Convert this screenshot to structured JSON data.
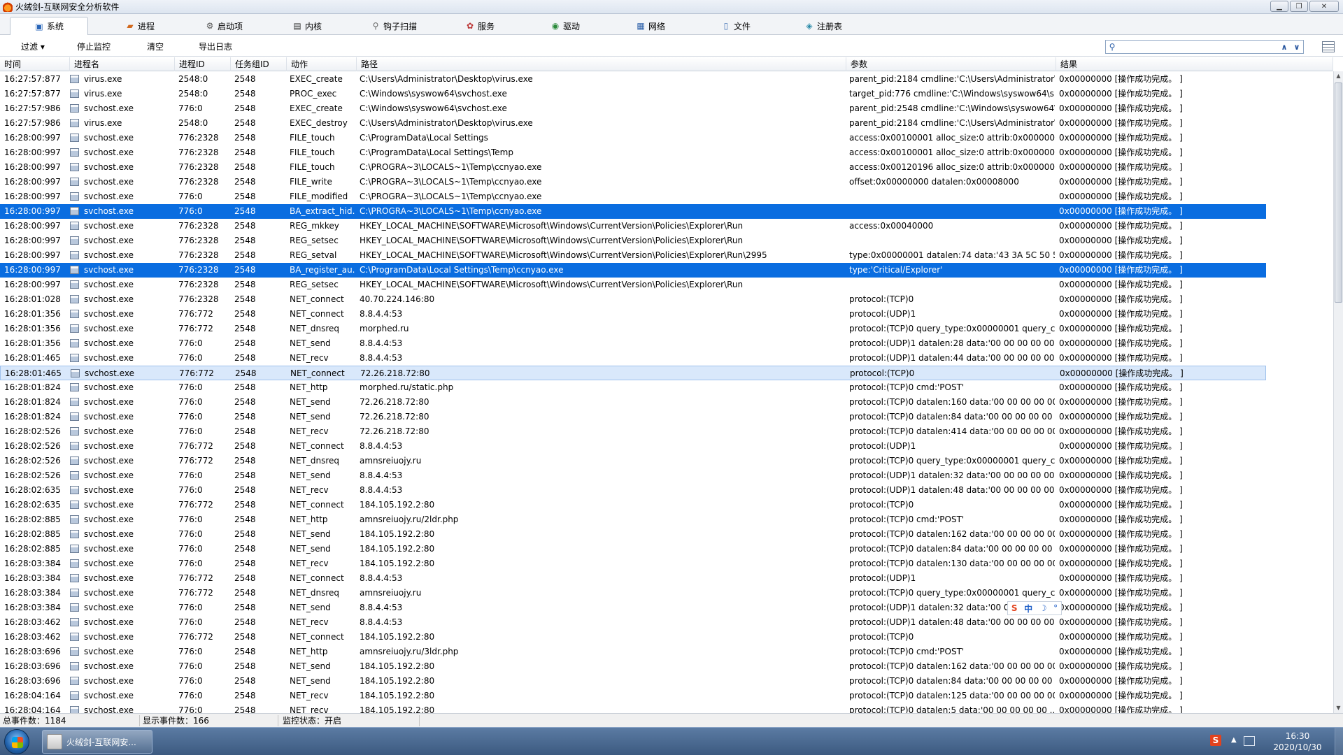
{
  "window": {
    "title": "火绒剑-互联网安全分析软件"
  },
  "tabs": [
    {
      "label": "系统",
      "icon": "system-icon",
      "active": true
    },
    {
      "label": "进程",
      "icon": "process-icon"
    },
    {
      "label": "启动项",
      "icon": "startup-icon"
    },
    {
      "label": "内核",
      "icon": "kernel-icon"
    },
    {
      "label": "钩子扫描",
      "icon": "hook-scan-icon"
    },
    {
      "label": "服务",
      "icon": "service-icon"
    },
    {
      "label": "驱动",
      "icon": "driver-icon"
    },
    {
      "label": "网络",
      "icon": "network-icon"
    },
    {
      "label": "文件",
      "icon": "file-icon"
    },
    {
      "label": "注册表",
      "icon": "registry-icon"
    }
  ],
  "toolbar": {
    "filter_label": "过滤 ▾",
    "stop_label": "停止监控",
    "clear_label": "清空",
    "export_label": "导出日志",
    "search_value": ""
  },
  "columns": [
    "时间",
    "进程名",
    "进程ID",
    "任务组ID",
    "动作",
    "路径",
    "参数",
    "结果"
  ],
  "rows": [
    {
      "t": "16:27:57:877",
      "p": "virus.exe",
      "pid": "2548:0",
      "g": "2548",
      "a": "EXEC_create",
      "path": "C:\\Users\\Administrator\\Desktop\\virus.exe",
      "arg": "parent_pid:2184 cmdline:'C:\\Users\\Administrator\\...",
      "res": "0x00000000 [操作成功完成。 ]"
    },
    {
      "t": "16:27:57:877",
      "p": "virus.exe",
      "pid": "2548:0",
      "g": "2548",
      "a": "PROC_exec",
      "path": "C:\\Windows\\syswow64\\svchost.exe",
      "arg": "target_pid:776 cmdline:'C:\\Windows\\syswow64\\s...",
      "res": "0x00000000 [操作成功完成。 ]"
    },
    {
      "t": "16:27:57:986",
      "p": "svchost.exe",
      "pid": "776:0",
      "g": "2548",
      "a": "EXEC_create",
      "path": "C:\\Windows\\syswow64\\svchost.exe",
      "arg": "parent_pid:2548 cmdline:'C:\\Windows\\syswow64\\...",
      "res": "0x00000000 [操作成功完成。 ]"
    },
    {
      "t": "16:27:57:986",
      "p": "virus.exe",
      "pid": "2548:0",
      "g": "2548",
      "a": "EXEC_destroy",
      "path": "C:\\Users\\Administrator\\Desktop\\virus.exe",
      "arg": "parent_pid:2184 cmdline:'C:\\Users\\Administrator\\...",
      "res": "0x00000000 [操作成功完成。 ]"
    },
    {
      "t": "16:28:00:997",
      "p": "svchost.exe",
      "pid": "776:2328",
      "g": "2548",
      "a": "FILE_touch",
      "path": "C:\\ProgramData\\Local Settings",
      "arg": "access:0x00100001 alloc_size:0 attrib:0x00000080...",
      "res": "0x00000000 [操作成功完成。 ]"
    },
    {
      "t": "16:28:00:997",
      "p": "svchost.exe",
      "pid": "776:2328",
      "g": "2548",
      "a": "FILE_touch",
      "path": "C:\\ProgramData\\Local Settings\\Temp",
      "arg": "access:0x00100001 alloc_size:0 attrib:0x00000080...",
      "res": "0x00000000 [操作成功完成。 ]"
    },
    {
      "t": "16:28:00:997",
      "p": "svchost.exe",
      "pid": "776:2328",
      "g": "2548",
      "a": "FILE_touch",
      "path": "C:\\PROGRA~3\\LOCALS~1\\Temp\\ccnyao.exe",
      "arg": "access:0x00120196 alloc_size:0 attrib:0x00000006...",
      "res": "0x00000000 [操作成功完成。 ]"
    },
    {
      "t": "16:28:00:997",
      "p": "svchost.exe",
      "pid": "776:2328",
      "g": "2548",
      "a": "FILE_write",
      "path": "C:\\PROGRA~3\\LOCALS~1\\Temp\\ccnyao.exe",
      "arg": "offset:0x00000000 datalen:0x00008000",
      "res": "0x00000000 [操作成功完成。 ]"
    },
    {
      "t": "16:28:00:997",
      "p": "svchost.exe",
      "pid": "776:0",
      "g": "2548",
      "a": "FILE_modified",
      "path": "C:\\PROGRA~3\\LOCALS~1\\Temp\\ccnyao.exe",
      "arg": "",
      "res": "0x00000000 [操作成功完成。 ]"
    },
    {
      "t": "16:28:00:997",
      "p": "svchost.exe",
      "pid": "776:0",
      "g": "2548",
      "a": "BA_extract_hid...",
      "path": "C:\\PROGRA~3\\LOCALS~1\\Temp\\ccnyao.exe",
      "arg": "",
      "res": "0x00000000 [操作成功完成。 ]",
      "state": "sel"
    },
    {
      "t": "16:28:00:997",
      "p": "svchost.exe",
      "pid": "776:2328",
      "g": "2548",
      "a": "REG_mkkey",
      "path": "HKEY_LOCAL_MACHINE\\SOFTWARE\\Microsoft\\Windows\\CurrentVersion\\Policies\\Explorer\\Run",
      "arg": "access:0x00040000",
      "res": "0x00000000 [操作成功完成。 ]"
    },
    {
      "t": "16:28:00:997",
      "p": "svchost.exe",
      "pid": "776:2328",
      "g": "2548",
      "a": "REG_setsec",
      "path": "HKEY_LOCAL_MACHINE\\SOFTWARE\\Microsoft\\Windows\\CurrentVersion\\Policies\\Explorer\\Run",
      "arg": "",
      "res": "0x00000000 [操作成功完成。 ]"
    },
    {
      "t": "16:28:00:997",
      "p": "svchost.exe",
      "pid": "776:2328",
      "g": "2548",
      "a": "REG_setval",
      "path": "HKEY_LOCAL_MACHINE\\SOFTWARE\\Microsoft\\Windows\\CurrentVersion\\Policies\\Explorer\\Run\\2995",
      "arg": "type:0x00000001 datalen:74 data:'43 3A 5C 50 52...",
      "res": "0x00000000 [操作成功完成。 ]"
    },
    {
      "t": "16:28:00:997",
      "p": "svchost.exe",
      "pid": "776:2328",
      "g": "2548",
      "a": "BA_register_au...",
      "path": "C:\\ProgramData\\Local Settings\\Temp\\ccnyao.exe",
      "arg": "type:'Critical/Explorer'",
      "res": "0x00000000 [操作成功完成。 ]",
      "state": "sel"
    },
    {
      "t": "16:28:00:997",
      "p": "svchost.exe",
      "pid": "776:2328",
      "g": "2548",
      "a": "REG_setsec",
      "path": "HKEY_LOCAL_MACHINE\\SOFTWARE\\Microsoft\\Windows\\CurrentVersion\\Policies\\Explorer\\Run",
      "arg": "",
      "res": "0x00000000 [操作成功完成。 ]"
    },
    {
      "t": "16:28:01:028",
      "p": "svchost.exe",
      "pid": "776:2328",
      "g": "2548",
      "a": "NET_connect",
      "path": "40.70.224.146:80",
      "arg": "protocol:(TCP)0",
      "res": "0x00000000 [操作成功完成。 ]"
    },
    {
      "t": "16:28:01:356",
      "p": "svchost.exe",
      "pid": "776:772",
      "g": "2548",
      "a": "NET_connect",
      "path": "8.8.4.4:53",
      "arg": "protocol:(UDP)1",
      "res": "0x00000000 [操作成功完成。 ]"
    },
    {
      "t": "16:28:01:356",
      "p": "svchost.exe",
      "pid": "776:772",
      "g": "2548",
      "a": "NET_dnsreq",
      "path": "morphed.ru",
      "arg": "protocol:(TCP)0 query_type:0x00000001 query_cl...",
      "res": "0x00000000 [操作成功完成。 ]"
    },
    {
      "t": "16:28:01:356",
      "p": "svchost.exe",
      "pid": "776:0",
      "g": "2548",
      "a": "NET_send",
      "path": "8.8.4.4:53",
      "arg": "protocol:(UDP)1 datalen:28 data:'00 00 00 00 00 ...",
      "res": "0x00000000 [操作成功完成。 ]"
    },
    {
      "t": "16:28:01:465",
      "p": "svchost.exe",
      "pid": "776:0",
      "g": "2548",
      "a": "NET_recv",
      "path": "8.8.4.4:53",
      "arg": "protocol:(UDP)1 datalen:44 data:'00 00 00 00 00 ...",
      "res": "0x00000000 [操作成功完成。 ]"
    },
    {
      "t": "16:28:01:465",
      "p": "svchost.exe",
      "pid": "776:772",
      "g": "2548",
      "a": "NET_connect",
      "path": "72.26.218.72:80",
      "arg": "protocol:(TCP)0",
      "res": "0x00000000 [操作成功完成。 ]",
      "state": "hl"
    },
    {
      "t": "16:28:01:824",
      "p": "svchost.exe",
      "pid": "776:0",
      "g": "2548",
      "a": "NET_http",
      "path": "morphed.ru/static.php",
      "arg": "protocol:(TCP)0 cmd:'POST'",
      "res": "0x00000000 [操作成功完成。 ]"
    },
    {
      "t": "16:28:01:824",
      "p": "svchost.exe",
      "pid": "776:0",
      "g": "2548",
      "a": "NET_send",
      "path": "72.26.218.72:80",
      "arg": "protocol:(TCP)0 datalen:160 data:'00 00 00 00 00...",
      "res": "0x00000000 [操作成功完成。 ]"
    },
    {
      "t": "16:28:01:824",
      "p": "svchost.exe",
      "pid": "776:0",
      "g": "2548",
      "a": "NET_send",
      "path": "72.26.218.72:80",
      "arg": "protocol:(TCP)0 datalen:84 data:'00 00 00 00 00 ...",
      "res": "0x00000000 [操作成功完成。 ]"
    },
    {
      "t": "16:28:02:526",
      "p": "svchost.exe",
      "pid": "776:0",
      "g": "2548",
      "a": "NET_recv",
      "path": "72.26.218.72:80",
      "arg": "protocol:(TCP)0 datalen:414 data:'00 00 00 00 00...",
      "res": "0x00000000 [操作成功完成。 ]"
    },
    {
      "t": "16:28:02:526",
      "p": "svchost.exe",
      "pid": "776:772",
      "g": "2548",
      "a": "NET_connect",
      "path": "8.8.4.4:53",
      "arg": "protocol:(UDP)1",
      "res": "0x00000000 [操作成功完成。 ]"
    },
    {
      "t": "16:28:02:526",
      "p": "svchost.exe",
      "pid": "776:772",
      "g": "2548",
      "a": "NET_dnsreq",
      "path": "amnsreiuojy.ru",
      "arg": "protocol:(TCP)0 query_type:0x00000001 query_cl...",
      "res": "0x00000000 [操作成功完成。 ]"
    },
    {
      "t": "16:28:02:526",
      "p": "svchost.exe",
      "pid": "776:0",
      "g": "2548",
      "a": "NET_send",
      "path": "8.8.4.4:53",
      "arg": "protocol:(UDP)1 datalen:32 data:'00 00 00 00 00 ...",
      "res": "0x00000000 [操作成功完成。 ]"
    },
    {
      "t": "16:28:02:635",
      "p": "svchost.exe",
      "pid": "776:0",
      "g": "2548",
      "a": "NET_recv",
      "path": "8.8.4.4:53",
      "arg": "protocol:(UDP)1 datalen:48 data:'00 00 00 00 00 ...",
      "res": "0x00000000 [操作成功完成。 ]"
    },
    {
      "t": "16:28:02:635",
      "p": "svchost.exe",
      "pid": "776:772",
      "g": "2548",
      "a": "NET_connect",
      "path": "184.105.192.2:80",
      "arg": "protocol:(TCP)0",
      "res": "0x00000000 [操作成功完成。 ]"
    },
    {
      "t": "16:28:02:885",
      "p": "svchost.exe",
      "pid": "776:0",
      "g": "2548",
      "a": "NET_http",
      "path": "amnsreiuojy.ru/2ldr.php",
      "arg": "protocol:(TCP)0 cmd:'POST'",
      "res": "0x00000000 [操作成功完成。 ]"
    },
    {
      "t": "16:28:02:885",
      "p": "svchost.exe",
      "pid": "776:0",
      "g": "2548",
      "a": "NET_send",
      "path": "184.105.192.2:80",
      "arg": "protocol:(TCP)0 datalen:162 data:'00 00 00 00 00...",
      "res": "0x00000000 [操作成功完成。 ]"
    },
    {
      "t": "16:28:02:885",
      "p": "svchost.exe",
      "pid": "776:0",
      "g": "2548",
      "a": "NET_send",
      "path": "184.105.192.2:80",
      "arg": "protocol:(TCP)0 datalen:84 data:'00 00 00 00 00 ...",
      "res": "0x00000000 [操作成功完成。 ]"
    },
    {
      "t": "16:28:03:384",
      "p": "svchost.exe",
      "pid": "776:0",
      "g": "2548",
      "a": "NET_recv",
      "path": "184.105.192.2:80",
      "arg": "protocol:(TCP)0 datalen:130 data:'00 00 00 00 00...",
      "res": "0x00000000 [操作成功完成。 ]"
    },
    {
      "t": "16:28:03:384",
      "p": "svchost.exe",
      "pid": "776:772",
      "g": "2548",
      "a": "NET_connect",
      "path": "8.8.4.4:53",
      "arg": "protocol:(UDP)1",
      "res": "0x00000000 [操作成功完成。 ]"
    },
    {
      "t": "16:28:03:384",
      "p": "svchost.exe",
      "pid": "776:772",
      "g": "2548",
      "a": "NET_dnsreq",
      "path": "amnsreiuojy.ru",
      "arg": "protocol:(TCP)0 query_type:0x00000001 query_cl...",
      "res": "0x00000000 [操作成功完成。 ]"
    },
    {
      "t": "16:28:03:384",
      "p": "svchost.exe",
      "pid": "776:0",
      "g": "2548",
      "a": "NET_send",
      "path": "8.8.4.4:53",
      "arg": "protocol:(UDP)1 datalen:32 data:'00 00",
      "res": "0x00000000 [操作成功完成。 ]"
    },
    {
      "t": "16:28:03:462",
      "p": "svchost.exe",
      "pid": "776:0",
      "g": "2548",
      "a": "NET_recv",
      "path": "8.8.4.4:53",
      "arg": "protocol:(UDP)1 datalen:48 data:'00 00 00 00 00 ...",
      "res": "0x00000000 [操作成功完成。 ]"
    },
    {
      "t": "16:28:03:462",
      "p": "svchost.exe",
      "pid": "776:772",
      "g": "2548",
      "a": "NET_connect",
      "path": "184.105.192.2:80",
      "arg": "protocol:(TCP)0",
      "res": "0x00000000 [操作成功完成。 ]"
    },
    {
      "t": "16:28:03:696",
      "p": "svchost.exe",
      "pid": "776:0",
      "g": "2548",
      "a": "NET_http",
      "path": "amnsreiuojy.ru/3ldr.php",
      "arg": "protocol:(TCP)0 cmd:'POST'",
      "res": "0x00000000 [操作成功完成。 ]"
    },
    {
      "t": "16:28:03:696",
      "p": "svchost.exe",
      "pid": "776:0",
      "g": "2548",
      "a": "NET_send",
      "path": "184.105.192.2:80",
      "arg": "protocol:(TCP)0 datalen:162 data:'00 00 00 00 00...",
      "res": "0x00000000 [操作成功完成。 ]"
    },
    {
      "t": "16:28:03:696",
      "p": "svchost.exe",
      "pid": "776:0",
      "g": "2548",
      "a": "NET_send",
      "path": "184.105.192.2:80",
      "arg": "protocol:(TCP)0 datalen:84 data:'00 00 00 00 00 ...",
      "res": "0x00000000 [操作成功完成。 ]"
    },
    {
      "t": "16:28:04:164",
      "p": "svchost.exe",
      "pid": "776:0",
      "g": "2548",
      "a": "NET_recv",
      "path": "184.105.192.2:80",
      "arg": "protocol:(TCP)0 datalen:125 data:'00 00 00 00 00...",
      "res": "0x00000000 [操作成功完成。 ]"
    },
    {
      "t": "16:28:04:164",
      "p": "svchost.exe",
      "pid": "776:0",
      "g": "2548",
      "a": "NET_recv",
      "path": "184.105.192.2:80",
      "arg": "protocol:(TCP)0 datalen:5 data:'00 00 00 00 00 ...",
      "res": "0x00000000 [操作成功完成。 ]"
    }
  ],
  "status": {
    "total": "总事件数：1184",
    "shown": "显示事件数：166",
    "monitor": "监控状态：开启"
  },
  "ime": {
    "brand": "S",
    "mode": "中",
    "moon": "☽",
    "dot": "°"
  },
  "taskbar": {
    "task_label": "火绒剑-互联网安...",
    "time": "16:30",
    "date": "2020/10/30",
    "tray_icon": "S"
  },
  "colors": {
    "selection": "#0a6de0",
    "hover_row": "#d9e8fb"
  }
}
